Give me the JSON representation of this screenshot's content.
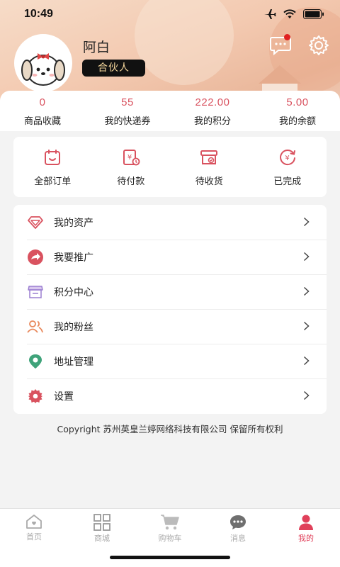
{
  "status_bar": {
    "time": "10:49"
  },
  "profile": {
    "name": "阿白",
    "role": "合伙人"
  },
  "stats": [
    {
      "value": "0",
      "label": "商品收藏"
    },
    {
      "value": "55",
      "label": "我的快递券"
    },
    {
      "value": "222.00",
      "label": "我的积分"
    },
    {
      "value": "5.00",
      "label": "我的余额"
    }
  ],
  "orders": [
    {
      "label": "全部订单",
      "icon": "all-orders-icon"
    },
    {
      "label": "待付款",
      "icon": "pending-payment-icon"
    },
    {
      "label": "待收货",
      "icon": "pending-receipt-icon"
    },
    {
      "label": "已完成",
      "icon": "completed-icon"
    }
  ],
  "menu": [
    {
      "label": "我的资产",
      "icon": "diamond-icon"
    },
    {
      "label": "我要推广",
      "icon": "share-icon"
    },
    {
      "label": "积分中心",
      "icon": "store-icon"
    },
    {
      "label": "我的粉丝",
      "icon": "fans-icon"
    },
    {
      "label": "地址管理",
      "icon": "location-icon"
    },
    {
      "label": "设置",
      "icon": "gear-icon"
    }
  ],
  "copyright": "Copyright 苏州英皇兰婷网络科技有限公司 保留所有权利",
  "tabs": [
    {
      "label": "首页",
      "icon": "home-icon"
    },
    {
      "label": "商城",
      "icon": "grid-icon"
    },
    {
      "label": "购物车",
      "icon": "cart-icon"
    },
    {
      "label": "消息",
      "icon": "message-icon"
    },
    {
      "label": "我的",
      "icon": "user-icon",
      "active": true
    }
  ],
  "colors": {
    "accent": "#d9525f",
    "tab_active": "#e0405a",
    "badge_bg": "#111111",
    "badge_text": "#f4d69c"
  }
}
